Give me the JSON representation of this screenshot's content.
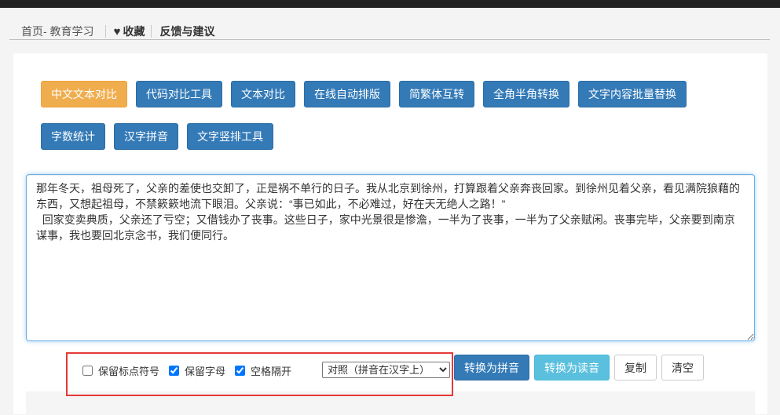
{
  "breadcrumb": {
    "home": "首页- 教育学习",
    "favorite_icon": "heart-icon",
    "favorite": "收藏",
    "feedback": "反馈与建议"
  },
  "tools": [
    {
      "label": "中文文本对比",
      "active": true
    },
    {
      "label": "代码对比工具",
      "active": false
    },
    {
      "label": "文本对比",
      "active": false
    },
    {
      "label": "在线自动排版",
      "active": false
    },
    {
      "label": "简繁体互转",
      "active": false
    },
    {
      "label": "全角半角转换",
      "active": false
    },
    {
      "label": "文字内容批量替换",
      "active": false
    },
    {
      "label": "字数统计",
      "active": false
    },
    {
      "label": "汉字拼音",
      "active": false
    },
    {
      "label": "文字竖排工具",
      "active": false
    }
  ],
  "editor": {
    "text": "那年冬天，祖母死了，父亲的差使也交卸了，正是祸不单行的日子。我从北京到徐州，打算跟着父亲奔丧回家。到徐州见着父亲，看见满院狼藉的东西，又想起祖母，不禁簌簌地流下眼泪。父亲说：“事已如此，不必难过，好在天无绝人之路！”\n  回家变卖典质，父亲还了亏空；又借钱办了丧事。这些日子，家中光景很是惨澹，一半为了丧事，一半为了父亲赋闲。丧事完毕，父亲要到南京谋事，我也要回北京念书，我们便同行。"
  },
  "options": [
    {
      "label": "保留标点符号",
      "checked": false
    },
    {
      "label": "保留字母",
      "checked": true
    },
    {
      "label": "空格隔开",
      "checked": true
    }
  ],
  "mode_select": {
    "selected": "对照（拼音在汉字上）"
  },
  "actions": {
    "to_pinyin": "转换为拼音",
    "to_reading": "转换为读音",
    "copy": "复制",
    "clear": "清空"
  },
  "colors": {
    "primary": "#337ab7",
    "active": "#f0ad4e",
    "info": "#5bc0de",
    "annotation": "#e53935",
    "topbar": "#232323"
  }
}
